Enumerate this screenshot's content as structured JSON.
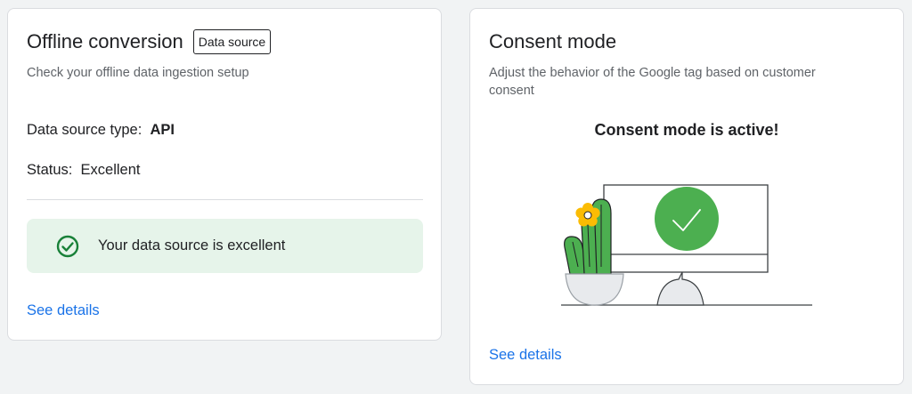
{
  "offline": {
    "title": "Offline conversion",
    "badge": "Data source",
    "subtitle": "Check your offline data ingestion setup",
    "source_type_label": "Data source type:",
    "source_type_value": "API",
    "status_label": "Status:",
    "status_value": "Excellent",
    "success_message": "Your data source is excellent",
    "details_link": "See details"
  },
  "consent": {
    "title": "Consent mode",
    "subtitle_line1": "Adjust the behavior of the Google tag based on customer",
    "subtitle_line2": "consent",
    "status_heading": "Consent mode is active!",
    "details_link": "See details",
    "illustration_icon": "monitor-with-checkmark-and-cactus"
  },
  "colors": {
    "accent_link": "#1a73e8",
    "success_bg": "#e6f4ea",
    "success_icon": "#188038",
    "check_circle": "#4caf50",
    "flower": "#fbbc04"
  }
}
